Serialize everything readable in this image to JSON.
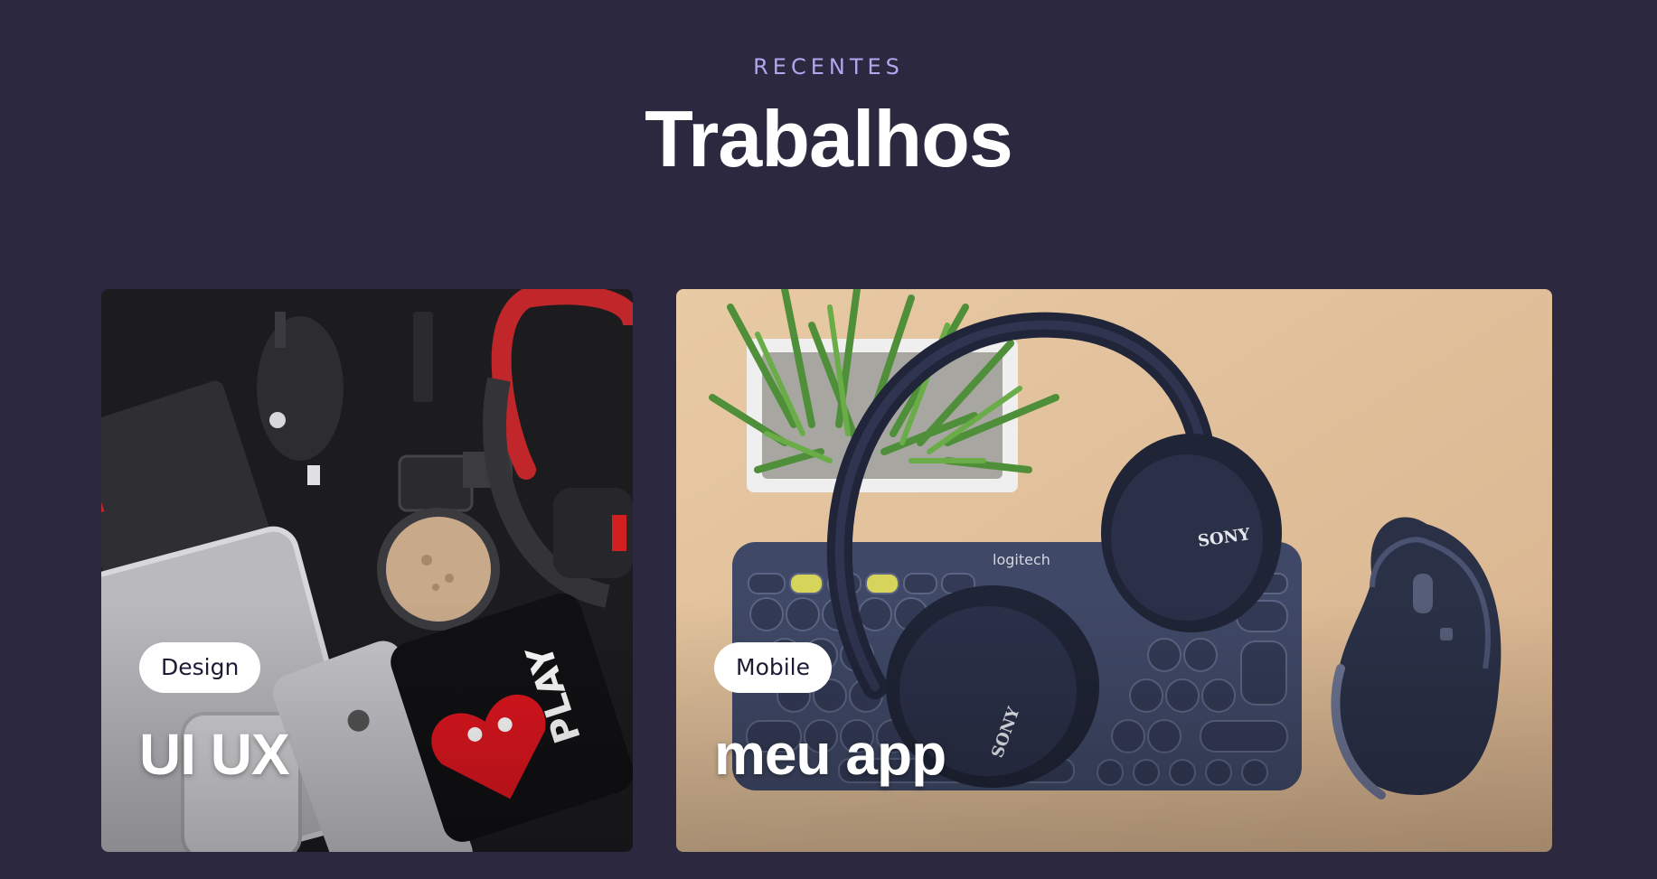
{
  "section": {
    "eyebrow": "RECENTES",
    "title": "Trabalhos"
  },
  "cards": [
    {
      "tag": "Design",
      "title": "UI UX",
      "image_icon": "desk-flatlay-photo"
    },
    {
      "tag": "Mobile",
      "title": "meu app",
      "image_icon": "headphones-keyboard-photo"
    }
  ],
  "colors": {
    "background": "#2b2840",
    "accent": "#b3a6ee",
    "text": "#ffffff",
    "tag_background": "#ffffff",
    "tag_text": "#1d1a33"
  }
}
